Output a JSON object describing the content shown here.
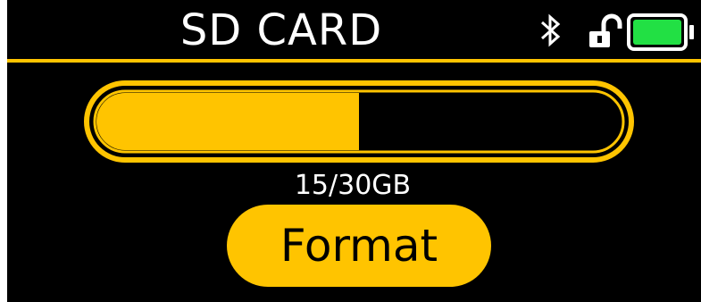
{
  "header": {
    "title": "SD CARD"
  },
  "status": {
    "bluetooth_icon": "bluetooth-icon",
    "lock_icon": "lock-unlocked-icon",
    "battery_icon": "battery-icon",
    "battery_level": 1.0
  },
  "storage": {
    "used_label": "15/30GB",
    "used_fraction": 0.5
  },
  "actions": {
    "format_label": "Format"
  },
  "colors": {
    "accent": "#ffc400",
    "background": "#000000",
    "text": "#ffffff",
    "battery": "#22e044"
  }
}
